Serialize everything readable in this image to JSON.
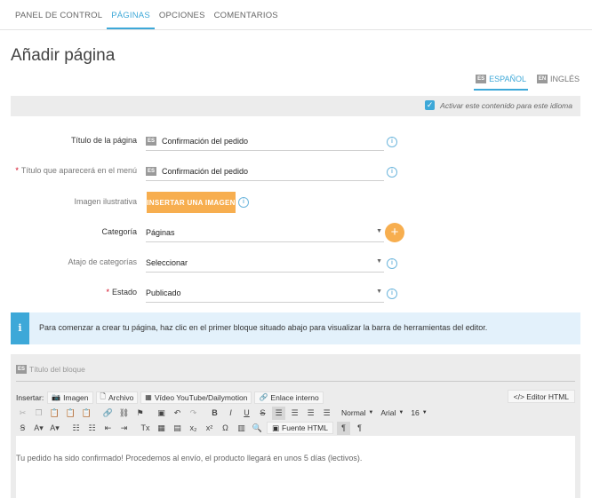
{
  "nav": {
    "tabs": [
      {
        "label": "PANEL DE CONTROL",
        "active": false
      },
      {
        "label": "PÁGINAS",
        "active": true
      },
      {
        "label": "OPCIONES",
        "active": false
      },
      {
        "label": "COMENTARIOS",
        "active": false
      }
    ]
  },
  "page": {
    "title": "Añadir página"
  },
  "languages": {
    "tabs": [
      {
        "code": "ES",
        "label": "ESPAÑOL",
        "active": true
      },
      {
        "code": "EN",
        "label": "INGLÉS",
        "active": false
      }
    ],
    "activate_label": "Activar este contenido para este idioma",
    "activate_checked": true
  },
  "form": {
    "title_label": "Título de la página",
    "title_value": "Confirmación del pedido",
    "title_flag": "ES",
    "menu_title_label": "Título que aparecerá en el menú",
    "menu_title_value": "Confirmación del pedido",
    "menu_title_flag": "ES",
    "required_mark": "*",
    "image_label": "Imagen ilustrativa",
    "image_button": "INSERTAR UNA IMAGEN",
    "category_label": "Categoría",
    "category_value": "Páginas",
    "shortcut_label": "Atajo de categorías",
    "shortcut_value": "Seleccionar",
    "status_label": "Estado",
    "status_value": "Publicado",
    "info_icon": "i",
    "add_symbol": "+"
  },
  "info": {
    "icon": "i",
    "text": "Para comenzar a crear tu página, haz clic en el primer bloque situado abajo para visualizar la barra de herramientas del editor."
  },
  "editor": {
    "block_flag": "ES",
    "block_title_placeholder": "Título del bloque",
    "insert_label": "Insertar:",
    "insert_buttons": [
      {
        "icon": "camera-icon",
        "label": "Imagen"
      },
      {
        "icon": "file-icon",
        "label": "Archivo"
      },
      {
        "icon": "film-icon",
        "label": "Vídeo YouTube/Dailymotion"
      },
      {
        "icon": "link-icon",
        "label": "Enlace interno"
      }
    ],
    "html_editor_label": "</> Editor HTML",
    "format_value": "Normal",
    "font_value": "Arial",
    "size_value": "16",
    "source_html_label": "Fuente HTML",
    "content": "Tu pedido ha sido confirmado! Procedemos al envío, el producto llegará en unos 5 días (lectivos)."
  }
}
